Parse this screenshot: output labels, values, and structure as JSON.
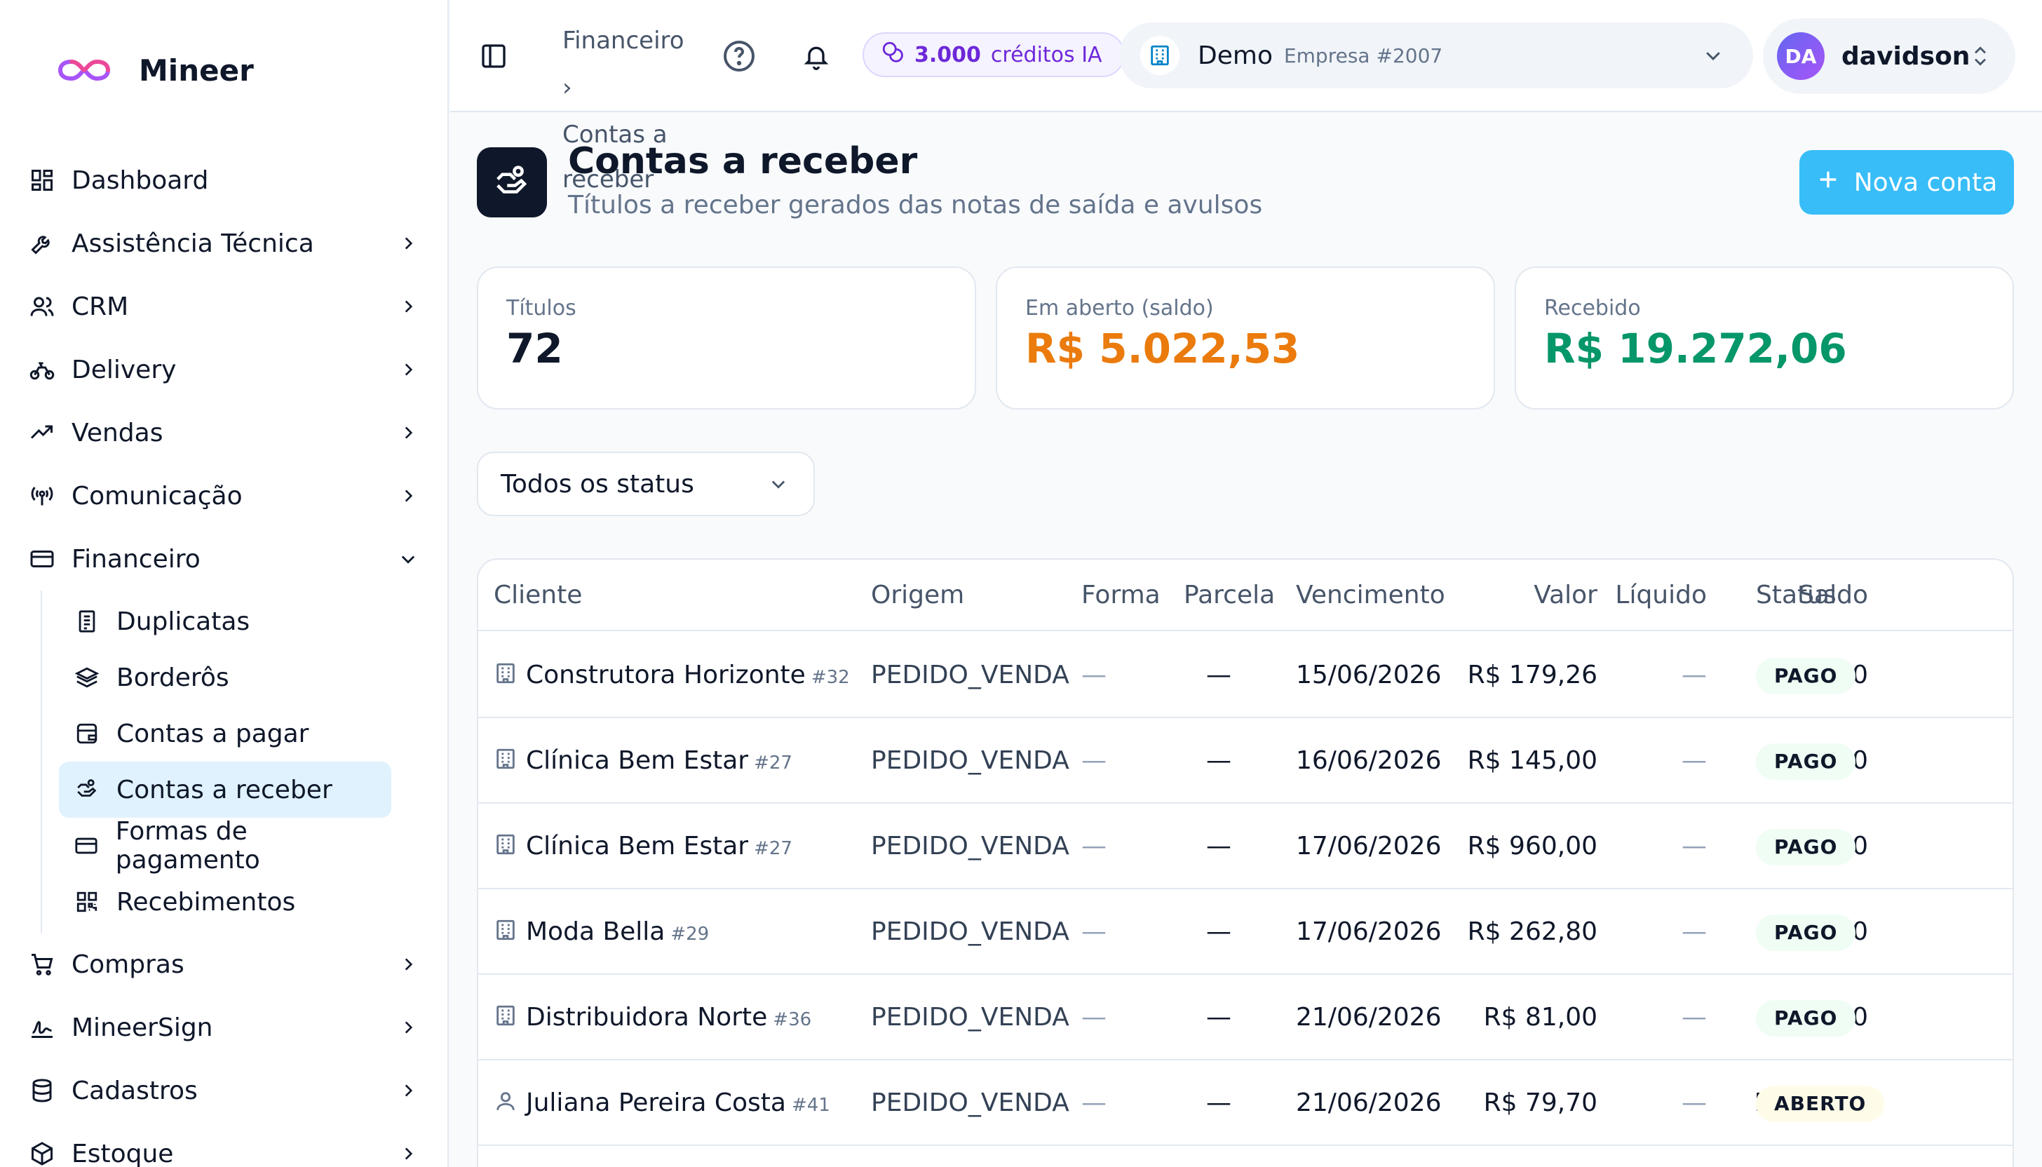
{
  "app": {
    "name": "Mineer"
  },
  "sidebar": {
    "items": [
      {
        "label": "Dashboard",
        "icon": "dashboard-icon"
      },
      {
        "label": "Assistência Técnica",
        "icon": "wrench-icon"
      },
      {
        "label": "CRM",
        "icon": "users-icon"
      },
      {
        "label": "Delivery",
        "icon": "bike-icon"
      },
      {
        "label": "Vendas",
        "icon": "trend-icon"
      },
      {
        "label": "Comunicação",
        "icon": "radio-icon"
      },
      {
        "label": "Financeiro",
        "icon": "wallet-icon",
        "expanded": true
      },
      {
        "label": "Compras",
        "icon": "cart-icon"
      },
      {
        "label": "MineerSign",
        "icon": "signature-icon"
      },
      {
        "label": "Cadastros",
        "icon": "database-icon"
      },
      {
        "label": "Estoque",
        "icon": "box-icon"
      }
    ],
    "financeiro_sub": [
      {
        "label": "Duplicatas",
        "icon": "document-icon"
      },
      {
        "label": "Borderôs",
        "icon": "layers-icon"
      },
      {
        "label": "Contas a pagar",
        "icon": "wallet-out-icon"
      },
      {
        "label": "Contas a receber",
        "icon": "hand-coins-icon",
        "active": true
      },
      {
        "label": "Formas de pagamento",
        "icon": "credit-card-icon"
      },
      {
        "label": "Recebimentos",
        "icon": "qr-code-icon"
      }
    ]
  },
  "header": {
    "breadcrumb": {
      "parent": "Financeiro",
      "separator": "›",
      "current": "Contas a receber"
    },
    "credits": {
      "amount": "3.000",
      "label": "créditos IA"
    },
    "company": {
      "name": "Demo",
      "sub": "Empresa #2007"
    },
    "user": {
      "initials": "DA",
      "name": "davidson"
    }
  },
  "page": {
    "title": "Contas a receber",
    "subtitle": "Títulos a receber gerados das notas de saída e avulsos",
    "new_button": "Nova conta"
  },
  "stats": {
    "titulos": {
      "label": "Títulos",
      "value": "72"
    },
    "aberto": {
      "label": "Em aberto (saldo)",
      "value": "R$ 5.022,53",
      "color": "#ea7b0c"
    },
    "recebido": {
      "label": "Recebido",
      "value": "R$ 19.272,06",
      "color": "#059669"
    }
  },
  "filter": {
    "status_selected": "Todos os status"
  },
  "table": {
    "headers": {
      "cliente": "Cliente",
      "origem": "Origem",
      "forma": "Forma",
      "parcela": "Parcela",
      "vencimento": "Vencimento",
      "valor": "Valor",
      "liquido": "Líquido",
      "saldo": "Saldo",
      "status": "Status"
    },
    "rows": [
      {
        "client_type": "company",
        "cliente": "Construtora Horizonte",
        "id": "#32",
        "origem": "PEDIDO_VENDA",
        "forma": "—",
        "parcela": "—",
        "vencimento": "15/06/2026",
        "valor": "R$ 179,26",
        "liquido": "—",
        "saldo": "R$ 0,00",
        "status": "PAGO"
      },
      {
        "client_type": "company",
        "cliente": "Clínica Bem Estar",
        "id": "#27",
        "origem": "PEDIDO_VENDA",
        "forma": "—",
        "parcela": "—",
        "vencimento": "16/06/2026",
        "valor": "R$ 145,00",
        "liquido": "—",
        "saldo": "R$ 0,00",
        "status": "PAGO"
      },
      {
        "client_type": "company",
        "cliente": "Clínica Bem Estar",
        "id": "#27",
        "origem": "PEDIDO_VENDA",
        "forma": "—",
        "parcela": "—",
        "vencimento": "17/06/2026",
        "valor": "R$ 960,00",
        "liquido": "—",
        "saldo": "R$ 0,00",
        "status": "PAGO"
      },
      {
        "client_type": "company",
        "cliente": "Moda Bella",
        "id": "#29",
        "origem": "PEDIDO_VENDA",
        "forma": "—",
        "parcela": "—",
        "vencimento": "17/06/2026",
        "valor": "R$ 262,80",
        "liquido": "—",
        "saldo": "R$ 0,00",
        "status": "PAGO"
      },
      {
        "client_type": "company",
        "cliente": "Distribuidora Norte",
        "id": "#36",
        "origem": "PEDIDO_VENDA",
        "forma": "—",
        "parcela": "—",
        "vencimento": "21/06/2026",
        "valor": "R$ 81,00",
        "liquido": "—",
        "saldo": "R$ 0,00",
        "status": "PAGO"
      },
      {
        "client_type": "person",
        "cliente": "Juliana Pereira Costa",
        "id": "#41",
        "origem": "PEDIDO_VENDA",
        "forma": "—",
        "parcela": "—",
        "vencimento": "21/06/2026",
        "valor": "R$ 79,70",
        "liquido": "—",
        "saldo": "R$ 79,70",
        "status": "ABERTO"
      }
    ]
  }
}
